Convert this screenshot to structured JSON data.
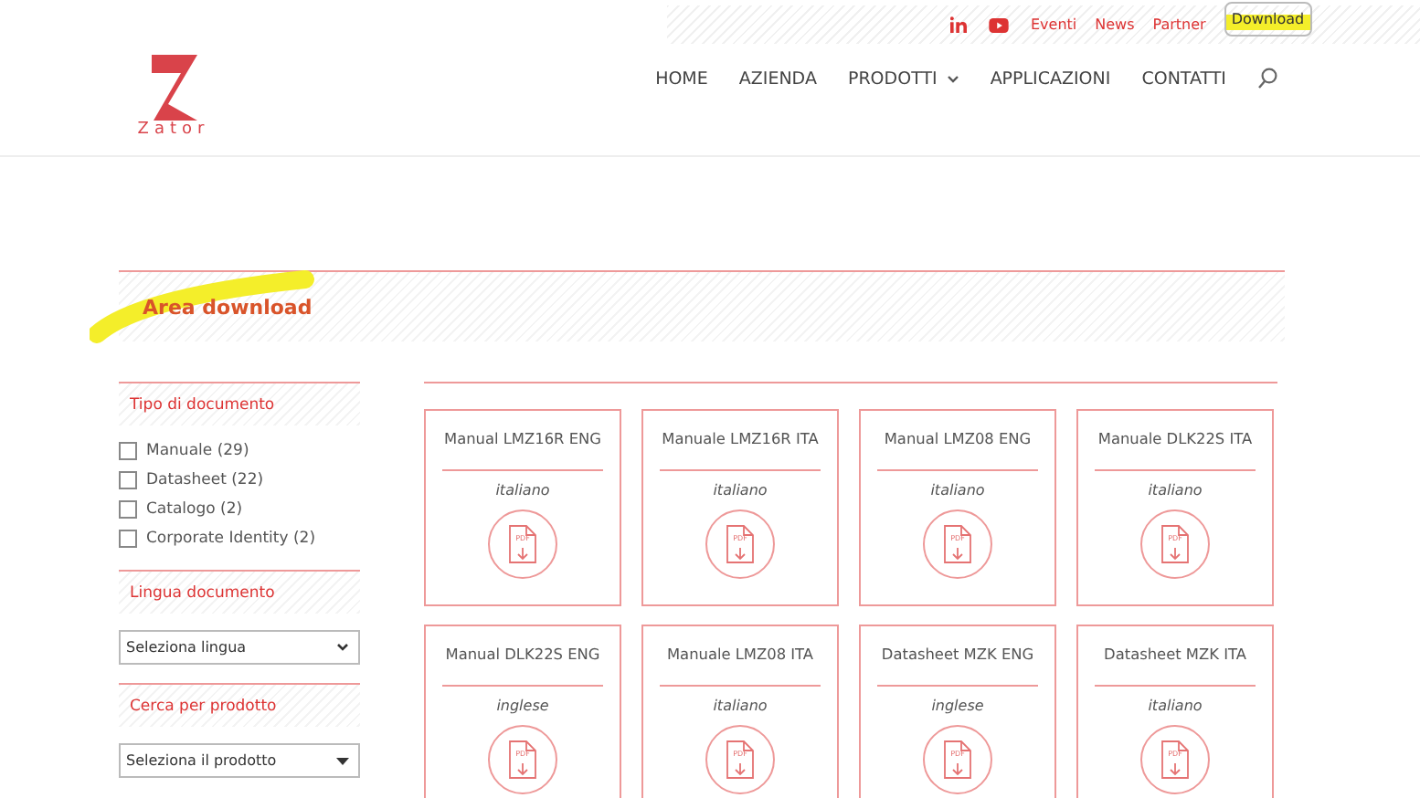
{
  "top_bar": {
    "links": [
      {
        "label": "Eventi",
        "selected": false
      },
      {
        "label": "News",
        "selected": false
      },
      {
        "label": "Partner",
        "selected": false
      },
      {
        "label": "Download",
        "selected": true
      }
    ]
  },
  "logo": {
    "text": "Zator"
  },
  "nav": {
    "items": [
      {
        "label": "HOME",
        "has_menu": false
      },
      {
        "label": "AZIENDA",
        "has_menu": false
      },
      {
        "label": "PRODOTTI",
        "has_menu": true
      },
      {
        "label": "APPLICAZIONI",
        "has_menu": false
      },
      {
        "label": "CONTATTI",
        "has_menu": false
      }
    ]
  },
  "section": {
    "title": "Area download"
  },
  "filters": {
    "doc_type": {
      "title": "Tipo di documento",
      "options": [
        {
          "label": "Manuale (29)",
          "checked": false
        },
        {
          "label": "Datasheet (22)",
          "checked": false
        },
        {
          "label": "Catalogo (2)",
          "checked": false
        },
        {
          "label": "Corporate Identity (2)",
          "checked": false
        }
      ]
    },
    "language": {
      "title": "Lingua documento",
      "value": "Seleziona lingua"
    },
    "product": {
      "title": "Cerca per prodotto",
      "value": "Seleziona il prodotto"
    }
  },
  "documents": [
    {
      "title": "Manual LMZ16R ENG",
      "language": "italiano",
      "icon_label": "PDF"
    },
    {
      "title": "Manuale LMZ16R ITA",
      "language": "italiano",
      "icon_label": "PDF"
    },
    {
      "title": "Manual LMZ08 ENG",
      "language": "italiano",
      "icon_label": "PDF"
    },
    {
      "title": "Manuale DLK22S ITA",
      "language": "italiano",
      "icon_label": "PDF"
    },
    {
      "title": "Manual DLK22S ENG",
      "language": "inglese",
      "icon_label": "PDF"
    },
    {
      "title": "Manuale LMZ08 ITA",
      "language": "italiano",
      "icon_label": "PDF"
    },
    {
      "title": "Datasheet MZK ENG",
      "language": "inglese",
      "icon_label": "PDF"
    },
    {
      "title": "Datasheet MZK ITA",
      "language": "italiano",
      "icon_label": "PDF"
    }
  ]
}
